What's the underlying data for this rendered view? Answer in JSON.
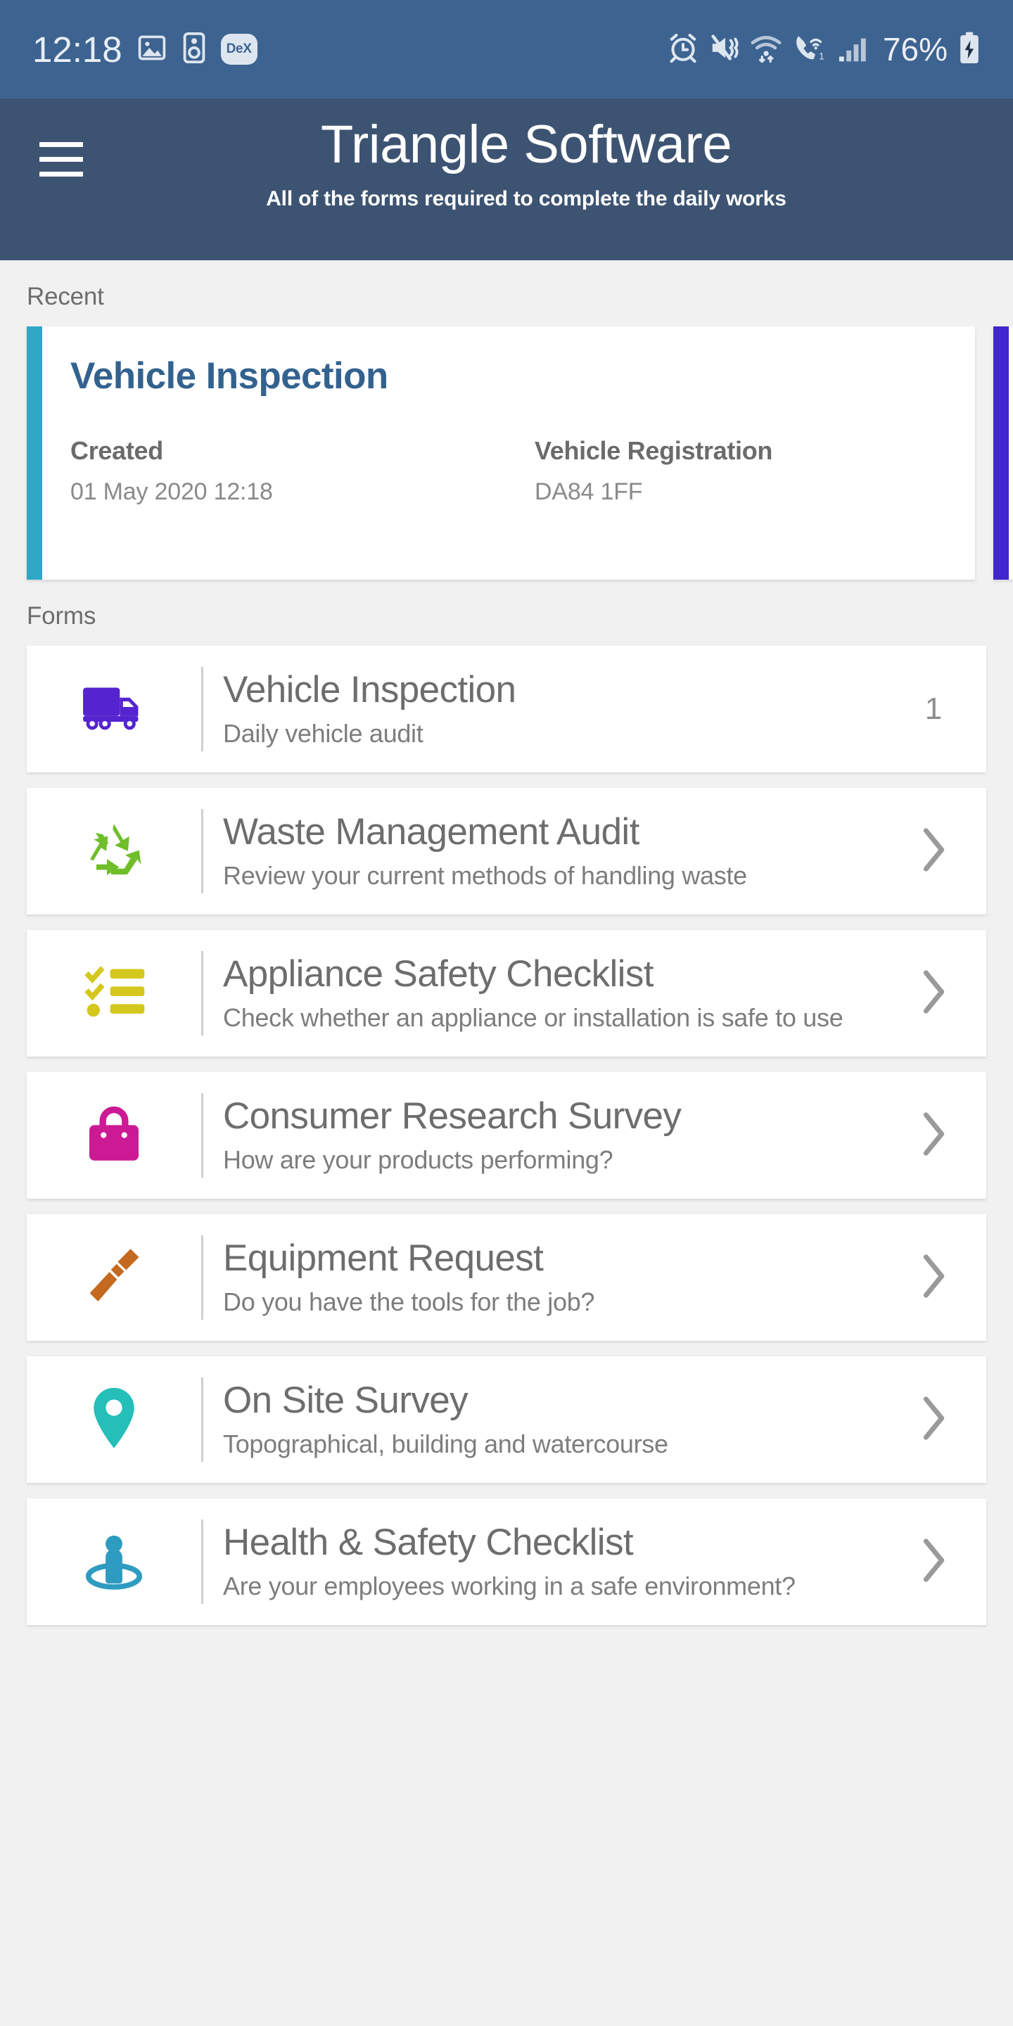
{
  "status_bar": {
    "time": "12:18",
    "battery_percent": "76%",
    "dex_label": "DeX",
    "icons": [
      "gallery-icon",
      "speaker-icon",
      "dex-icon",
      "alarm-icon",
      "mute-vibrate-icon",
      "wifi-data-icon",
      "wifi-calling-icon",
      "signal-bars-icon",
      "battery-charging-icon"
    ],
    "background": "#3d6390"
  },
  "app_bar": {
    "menu_icon": "hamburger-menu-icon",
    "title": "Triangle Software",
    "subtitle": "All of the forms required to complete the daily works",
    "background": "#3d5372"
  },
  "recent": {
    "section_label": "Recent",
    "card": {
      "accent_color": "#2ea8c4",
      "title": "Vehicle Inspection",
      "fields": [
        {
          "label": "Created",
          "value": "01 May 2020 12:18"
        },
        {
          "label": "Vehicle Registration",
          "value": "DA84 1FF"
        }
      ]
    },
    "next_card_accent_color": "#4026cc"
  },
  "forms": {
    "section_label": "Forms",
    "items": [
      {
        "icon": "truck-icon",
        "icon_color": "#5524d0",
        "title": "Vehicle Inspection",
        "subtitle": "Daily vehicle audit",
        "count": "1",
        "trailing": "count"
      },
      {
        "icon": "recycle-icon",
        "icon_color": "#6fbe2a",
        "title": "Waste Management Audit",
        "subtitle": "Review your current methods of handling waste",
        "count": "",
        "trailing": "chevron"
      },
      {
        "icon": "checklist-icon",
        "icon_color": "#d4c81e",
        "title": "Appliance Safety Checklist",
        "subtitle": "Check whether an appliance or installation is safe to use",
        "count": "",
        "trailing": "chevron"
      },
      {
        "icon": "shopping-bag-icon",
        "icon_color": "#cc1a95",
        "title": "Consumer Research Survey",
        "subtitle": "How are your products performing?",
        "count": "",
        "trailing": "chevron"
      },
      {
        "icon": "screwdriver-icon",
        "icon_color": "#c4691f",
        "title": "Equipment Request",
        "subtitle": "Do you have the tools for the job?",
        "count": "",
        "trailing": "chevron"
      },
      {
        "icon": "map-pin-icon",
        "icon_color": "#23bfb8",
        "title": "On Site Survey",
        "subtitle": "Topographical, building and watercourse",
        "count": "",
        "trailing": "chevron"
      },
      {
        "icon": "person-in-circle-icon",
        "icon_color": "#2e9bc0",
        "title": "Health & Safety Checklist",
        "subtitle": "Are your employees working in a safe environment?",
        "count": "",
        "trailing": "chevron"
      }
    ]
  }
}
